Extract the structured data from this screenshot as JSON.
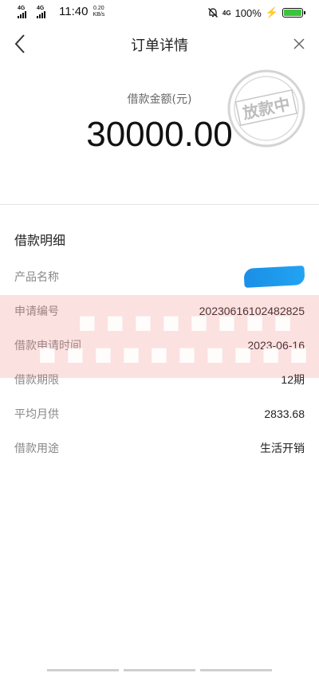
{
  "status_bar": {
    "network_1": "4G",
    "network_2": "4G",
    "time": "11:40",
    "speed_value": "0.20",
    "speed_unit": "KB/s",
    "network_right": "4G",
    "battery": "100%"
  },
  "nav": {
    "title": "订单详情"
  },
  "amount": {
    "label": "借款金额(元)",
    "value": "30000.00",
    "stamp_text": "放款中"
  },
  "detail": {
    "title": "借款明细",
    "rows": [
      {
        "label": "产品名称",
        "value": ""
      },
      {
        "label": "申请编号",
        "value": "20230616102482825"
      },
      {
        "label": "借款申请时间",
        "value": "2023-06-16"
      },
      {
        "label": "借款期限",
        "value": "12期"
      },
      {
        "label": "平均月供",
        "value": "2833.68"
      },
      {
        "label": "借款用途",
        "value": "生活开销"
      }
    ]
  }
}
